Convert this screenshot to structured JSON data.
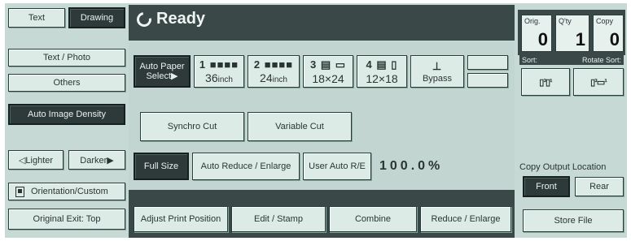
{
  "status": {
    "text": "Ready"
  },
  "left_panel": {
    "text_label": "Text",
    "drawing_label": "Drawing",
    "text_photo_label": "Text / Photo",
    "others_label": "Others",
    "auto_image_density_label": "Auto Image Density",
    "lighter_label": "◁Lighter",
    "darker_label": "Darker▶",
    "orientation_label": "Orientation/Custom",
    "original_exit_label": "Original Exit: Top"
  },
  "paper": {
    "auto_paper_line1": "Auto Paper",
    "auto_paper_line2": "Select▶",
    "trays": [
      {
        "slot": "1 ■■■■",
        "size": "36",
        "unit": "inch"
      },
      {
        "slot": "2 ■■■■",
        "size": "24",
        "unit": "inch"
      },
      {
        "slot": "3 ▤ ▭",
        "size": "18×24",
        "unit": ""
      },
      {
        "slot": "4 ▤ ▯",
        "size": "12×18",
        "unit": ""
      }
    ],
    "bypass_label": "Bypass"
  },
  "cut": {
    "synchro_label": "Synchro Cut",
    "variable_label": "Variable Cut"
  },
  "reduce": {
    "full_size_label": "Full Size",
    "auto_reduce_label": "Auto Reduce / Enlarge",
    "user_auto_label": "User Auto R/E",
    "ratio_text": "100.0%"
  },
  "bottom": {
    "adjust_label": "Adjust Print Position",
    "edit_label": "Edit / Stamp",
    "combine_label": "Combine",
    "reduce_enlarge_label": "Reduce / Enlarge"
  },
  "right_panel": {
    "orig_label": "Orig.",
    "orig_value": "0",
    "qty_label": "Q'ty",
    "qty_value": "1",
    "copy_label": "Copy",
    "copy_value": "0",
    "sort_label": "Sort:",
    "rotate_sort_label": "Rotate Sort:",
    "copy_output_label": "Copy Output Location",
    "front_label": "Front",
    "rear_label": "Rear",
    "store_file_label": "Store File"
  }
}
